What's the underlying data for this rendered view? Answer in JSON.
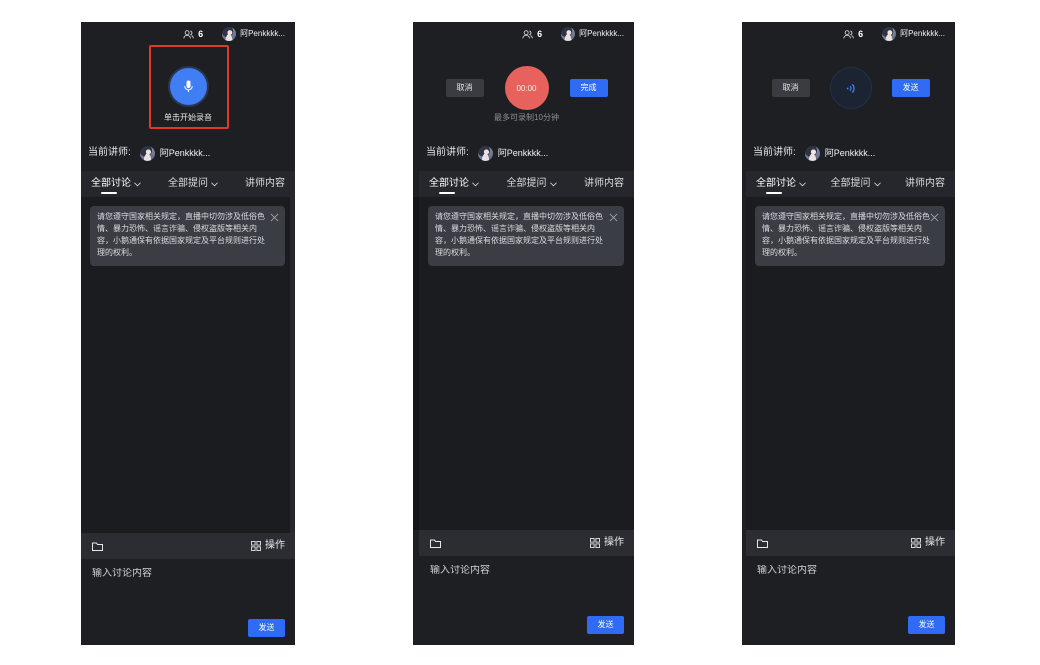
{
  "colors": {
    "accent": "#2f6bf5",
    "mic": "#3f7ef3",
    "record": "#e8625d",
    "highlight": "#e0392b",
    "wave": "#4a86ff"
  },
  "panels": [
    {
      "header": {
        "viewer_icon": "users-icon",
        "viewer_count": "6",
        "username": "阿Penkkkk..."
      },
      "record": {
        "icon": "microphone-icon",
        "hint": "单击开始录音"
      },
      "lecturer": {
        "label": "当前讲师:",
        "name": "阿Penkkkk..."
      },
      "tabs": [
        {
          "label": "全部讨论",
          "icon": "chevron-down-icon",
          "active": true
        },
        {
          "label": "全部提问",
          "icon": "chevron-down-icon"
        },
        {
          "label": "讲师内容"
        }
      ],
      "notice": {
        "text": "请您遵守国家相关规定，直播中切勿涉及低俗色情、暴力恐怖、谣言诈骗、侵权盗版等相关内容，小鹅通保有依据国家规定及平台规则进行处理的权利。",
        "close_icon": "close-icon"
      },
      "toolbar": {
        "folder_icon": "folder-icon",
        "actions_icon": "grid-icon",
        "actions_label": "操作"
      },
      "input": {
        "placeholder": "输入讨论内容"
      },
      "send_label": "发送"
    },
    {
      "header": {
        "viewer_icon": "users-icon",
        "viewer_count": "6",
        "username": "阿Penkkkk..."
      },
      "record": {
        "cancel_label": "取消",
        "timer": "00:00",
        "done_label": "完成",
        "hint": "最多可录制10分钟"
      },
      "lecturer": {
        "label": "当前讲师:",
        "name": "阿Penkkkk..."
      },
      "tabs": [
        {
          "label": "全部讨论",
          "icon": "chevron-down-icon",
          "active": true
        },
        {
          "label": "全部提问",
          "icon": "chevron-down-icon"
        },
        {
          "label": "讲师内容"
        }
      ],
      "notice": {
        "text": "请您遵守国家相关规定，直播中切勿涉及低俗色情、暴力恐怖、谣言诈骗、侵权盗版等相关内容，小鹅通保有依据国家规定及平台规则进行处理的权利。",
        "close_icon": "close-icon"
      },
      "toolbar": {
        "folder_icon": "folder-icon",
        "actions_icon": "grid-icon",
        "actions_label": "操作"
      },
      "input": {
        "placeholder": "输入讨论内容"
      },
      "send_label": "发送"
    },
    {
      "header": {
        "viewer_icon": "users-icon",
        "viewer_count": "6",
        "username": "阿Penkkkk..."
      },
      "record": {
        "cancel_label": "取消",
        "icon": "sound-wave-icon",
        "send_label": "发送"
      },
      "lecturer": {
        "label": "当前讲师:",
        "name": "阿Penkkkk..."
      },
      "tabs": [
        {
          "label": "全部讨论",
          "icon": "chevron-down-icon",
          "active": true
        },
        {
          "label": "全部提问",
          "icon": "chevron-down-icon"
        },
        {
          "label": "讲师内容"
        }
      ],
      "notice": {
        "text": "请您遵守国家相关规定，直播中切勿涉及低俗色情、暴力恐怖、谣言诈骗、侵权盗版等相关内容，小鹅通保有依据国家规定及平台规则进行处理的权利。",
        "close_icon": "close-icon"
      },
      "toolbar": {
        "folder_icon": "folder-icon",
        "actions_icon": "grid-icon",
        "actions_label": "操作"
      },
      "input": {
        "placeholder": "输入讨论内容"
      },
      "send_label": "发送"
    }
  ]
}
